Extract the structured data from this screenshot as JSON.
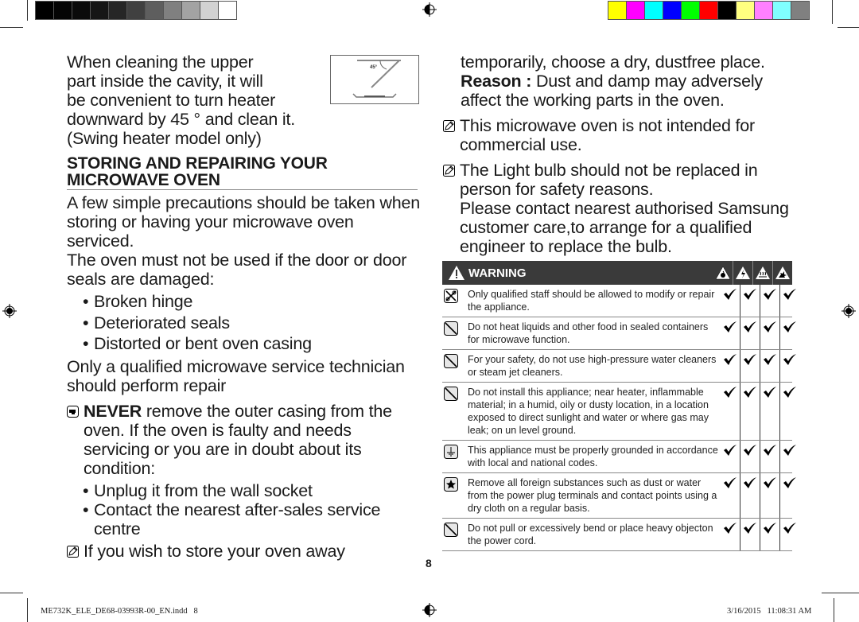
{
  "print_marks": {
    "grayscale_swatches": [
      "#000000",
      "#040404",
      "#0b0b0b",
      "#161616",
      "#262626",
      "#404040",
      "#5e5e5e",
      "#808080",
      "#a3a3a3",
      "#d2d2d2",
      "#ffffff"
    ],
    "color_swatches": [
      "#ffff00",
      "#ff00ff",
      "#00ffff",
      "#0000ff",
      "#00ff00",
      "#ff0000",
      "#000000",
      "#ffff80",
      "#ff80ff",
      "#80ffff",
      "#808080"
    ]
  },
  "left_column": {
    "intro_lines": [
      "When cleaning the upper",
      "part inside the cavity, it will",
      "be convenient to turn heater",
      "downward by 45 ° and clean it.",
      "(Swing heater model only)"
    ],
    "figure_label": "45°",
    "section_heading_line1": "STORING AND REPAIRING YOUR",
    "section_heading_line2": "MICROWAVE OVEN",
    "para1": "A few simple precautions should be taken when storing or having your microwave oven serviced.",
    "para2": "The oven must not be used if the door or door seals are damaged:",
    "damage_bullets": [
      "Broken hinge",
      "Deteriorated seals",
      "Distorted or bent oven casing"
    ],
    "para3": "Only a qualified microwave service technician should perform repair",
    "never_bold": "NEVER",
    "never_text": " remove the outer casing from the oven. If the oven is faulty and needs servicing or you are in doubt about its condition:",
    "condition_bullets": [
      "Unplug it from the wall socket",
      "Contact the nearest after-sales service centre"
    ],
    "store_note": "If you wish to store your oven away"
  },
  "right_column": {
    "store_continued": "temporarily, choose a dry, dustfree place.",
    "reason_bold": "Reason :",
    "reason_text": " Dust and damp may adversely affect the working parts in the oven.",
    "note_commercial": "This microwave oven is not intended for commercial use.",
    "note_bulb": "The Light bulb should not be replaced in person for safety reasons.",
    "note_bulb_contact": "Please contact nearest authorised Samsung customer care,to arrange for a qualified engineer to replace the bulb."
  },
  "warning_table": {
    "title": "WARNING",
    "header_icons": [
      "fire-hazard-icon",
      "electric-shock-icon",
      "hot-surface-icon",
      "explosion-icon"
    ],
    "check_glyph": "✔",
    "rows": [
      {
        "icon": "no-disassembly-icon",
        "text": "Only qualified staff should be allowed to modify or repair the appliance.",
        "checks": [
          true,
          true,
          true,
          true
        ]
      },
      {
        "icon": "prohibited-icon",
        "text": "Do not heat liquids and other food in sealed containers for microwave function.",
        "checks": [
          true,
          true,
          true,
          true
        ]
      },
      {
        "icon": "prohibited-icon",
        "text": "For your safety, do not use high-pressure water cleaners or steam jet cleaners.",
        "checks": [
          true,
          true,
          true,
          true
        ]
      },
      {
        "icon": "prohibited-icon",
        "text": "Do not install this appliance; near heater, inflammable material; in a humid, oily or dusty location, in a location exposed to direct sunlight and water or where gas may leak; on un level ground.",
        "checks": [
          true,
          true,
          true,
          true
        ]
      },
      {
        "icon": "ground-icon",
        "text": "This appliance must be properly grounded in accordance with local and national codes.",
        "checks": [
          true,
          true,
          true,
          true
        ]
      },
      {
        "icon": "star-icon",
        "text": "Remove all foreign substances such as dust or water from the power plug terminals and contact points using a dry cloth on a regular basis.",
        "checks": [
          true,
          true,
          true,
          true
        ]
      },
      {
        "icon": "prohibited-icon",
        "text": "Do not pull or excessively bend or place heavy objecton the power cord.",
        "checks": [
          true,
          true,
          true,
          true
        ]
      }
    ]
  },
  "page_number": "8",
  "footer": {
    "file_name": "ME732K_ELE_DE68-03993R-00_EN.indd   8",
    "timestamp": "3/16/2015   11:08:31 AM"
  }
}
